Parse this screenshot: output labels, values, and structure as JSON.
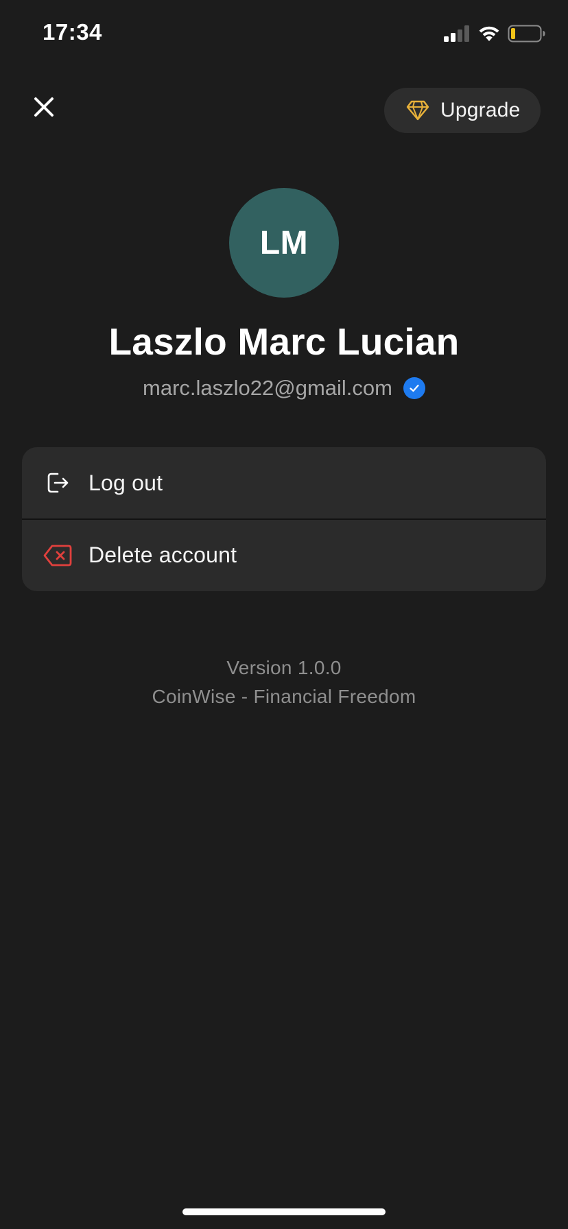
{
  "status_bar": {
    "time": "17:34",
    "battery_color": "#f0c419"
  },
  "header": {
    "close_icon": "close-icon",
    "upgrade_label": "Upgrade",
    "upgrade_icon": "diamond-icon",
    "upgrade_icon_color": "#e8b13a"
  },
  "profile": {
    "initials": "LM",
    "avatar_color": "#326160",
    "name": "Laszlo Marc Lucian",
    "email": "marc.laszlo22@gmail.com",
    "verified": true,
    "verified_color": "#1e7bf0"
  },
  "actions": {
    "logout_label": "Log out",
    "logout_icon": "logout-icon",
    "delete_label": "Delete account",
    "delete_icon": "delete-account-icon",
    "delete_color": "#e0403d"
  },
  "footer": {
    "version": "Version 1.0.0",
    "tagline": "CoinWise - Financial Freedom"
  }
}
